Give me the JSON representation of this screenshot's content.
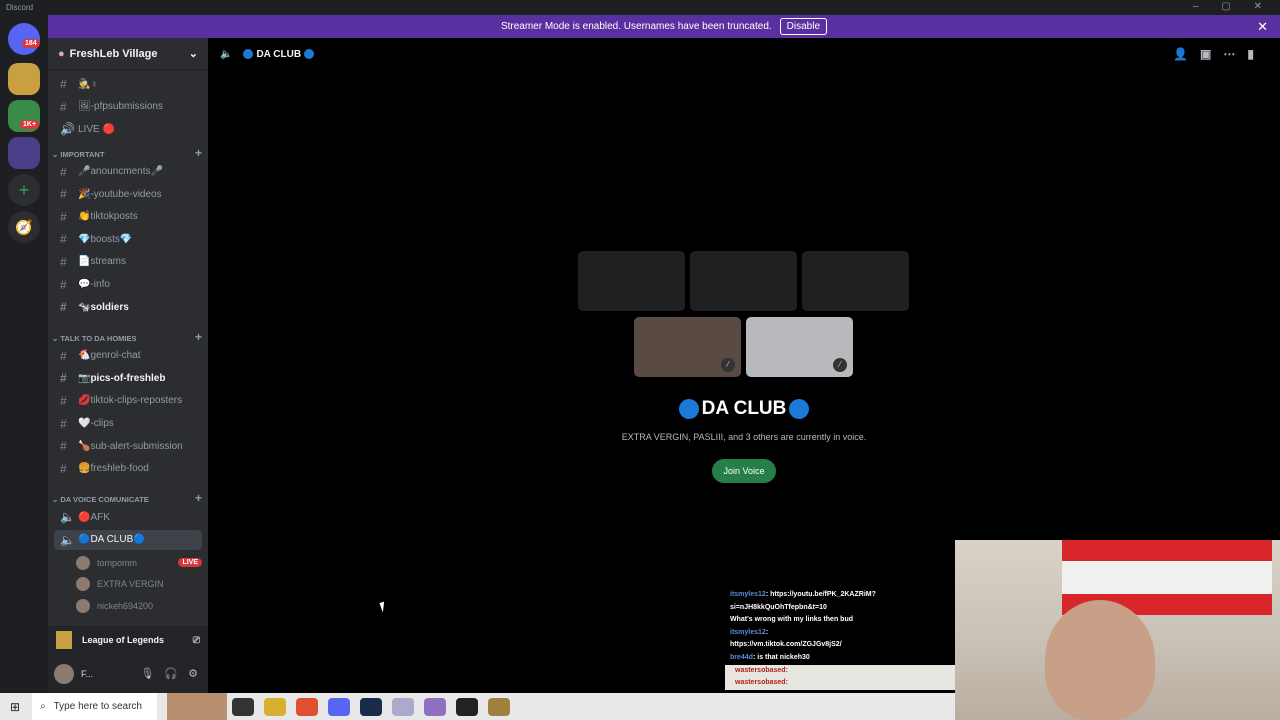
{
  "app": {
    "title": "Discord"
  },
  "banner": {
    "text": "Streamer Mode is enabled. Usernames have been truncated.",
    "button": "Disable"
  },
  "guilds": {
    "badges": [
      "184",
      "1K+"
    ]
  },
  "server": {
    "name": "FreshLeb Village"
  },
  "channels": [
    {
      "icon": "#",
      "label": "🕵️♀",
      "unread": false
    },
    {
      "icon": "#",
      "label": "🖼-pfpsubmissions",
      "unread": false
    },
    {
      "icon": "🔊",
      "label": "LIVE 🔴",
      "unread": false
    }
  ],
  "categories": [
    {
      "name": "IMPORTANT",
      "channels": [
        "🎤anouncments🎤",
        "🎉-youtube-videos",
        "👏tiktokposts",
        "💎boosts💎",
        "📄streams",
        "💬-info",
        "🐄soldiers"
      ]
    },
    {
      "name": "TALK TO DA HOMIES",
      "channels": [
        "🐔genrol-chat",
        "📷pics-of-freshleb",
        "💋tiktok-clips-reposters",
        "🤍-clips",
        "🍗sub-alert-submission",
        "🍔freshleb-food"
      ]
    },
    {
      "name": "DA VOICE COMUNICATE",
      "channels": [
        "🔴AFK",
        "🔵DA CLUB🔵"
      ]
    }
  ],
  "voice_users": [
    {
      "name": "tompomm",
      "status": "LIVE"
    },
    {
      "name": "EXTRA VERGIN",
      "status": ""
    },
    {
      "name": "nickeh694200",
      "status": ""
    }
  ],
  "activity": {
    "label": "League of Legends"
  },
  "user": {
    "name": "F..."
  },
  "main": {
    "channel": "DA CLUB",
    "title": "DA CLUB",
    "subtitle": "EXTRA VERGIN, PASLIII, and 3 others are currently in voice.",
    "join": "Join Voice"
  },
  "chat": [
    {
      "user": "itsmyles12",
      "msg": "https://youtu.be/fPK_2KAZRiM?"
    },
    {
      "user": "",
      "msg": "si=nJH8kkQuOhTfepbn&t=10"
    },
    {
      "user": "",
      "msg": "What's wrong with my links then bud"
    },
    {
      "user": "itsmyles12",
      "msg": ""
    },
    {
      "user": "",
      "msg": "https://vm.tiktok.com/ZGJGv8jS2/"
    },
    {
      "user": "",
      "msg": ""
    },
    {
      "user": "bre44d",
      "msg": "is that nickeh30"
    },
    {
      "user": "",
      "msg": ""
    },
    {
      "user": "wastersobased",
      "msg": ""
    },
    {
      "user": "wastersobased",
      "msg": ""
    }
  ],
  "taskbar": {
    "search_placeholder": "Type here to search"
  }
}
